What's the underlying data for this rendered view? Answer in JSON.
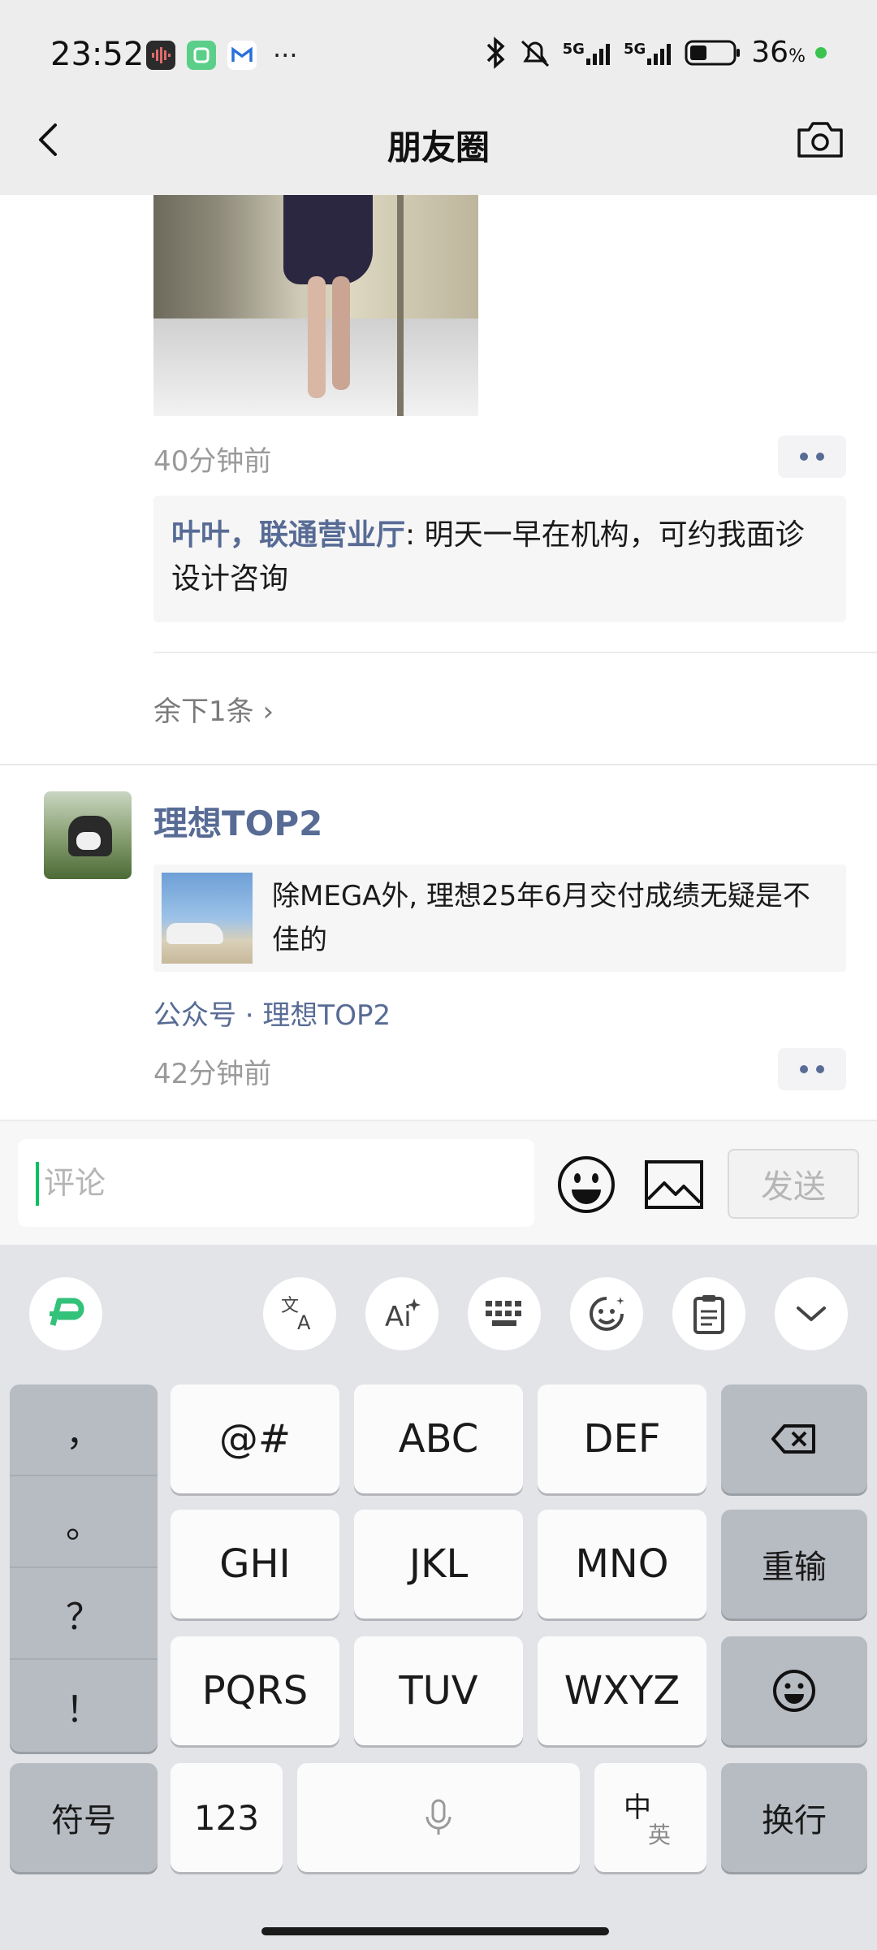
{
  "status_bar": {
    "time": "23:52",
    "app_icons": [
      "sound-app-icon",
      "meitu-app-icon",
      "gmail-app-icon"
    ],
    "more": "···",
    "network_1": "5G",
    "network_2": "5G",
    "battery": "36",
    "battery_unit": "%"
  },
  "nav": {
    "title": "朋友圈"
  },
  "post1": {
    "time": "40分钟前",
    "comment_author": "叶叶，联通营业厅",
    "comment_text": ": 明天一早在机构，可约我面诊设计咨询",
    "remaining": "余下1条 ›"
  },
  "post2": {
    "author": "理想TOP2",
    "link_title": "除MEGA外, 理想25年6月交付成绩无疑是不佳的",
    "source": "公众号 · 理想TOP2",
    "time": "42分钟前"
  },
  "comment_bar": {
    "placeholder": "评论",
    "send_label": "发送"
  },
  "keyboard": {
    "punctuation": [
      "，",
      "。",
      "？",
      "！"
    ],
    "row1": [
      "@#",
      "ABC",
      "DEF"
    ],
    "row2": [
      "GHI",
      "JKL",
      "MNO"
    ],
    "row2_action": "重输",
    "row3": [
      "PQRS",
      "TUV",
      "WXYZ"
    ],
    "symbols": "符号",
    "numbers": "123",
    "lang_top": "中",
    "lang_bottom": "英",
    "enter": "换行"
  },
  "colors": {
    "link_blue": "#576b95",
    "wechat_green": "#07c160",
    "header_gray": "#ededed",
    "keyboard_bg": "#e3e4e8"
  }
}
